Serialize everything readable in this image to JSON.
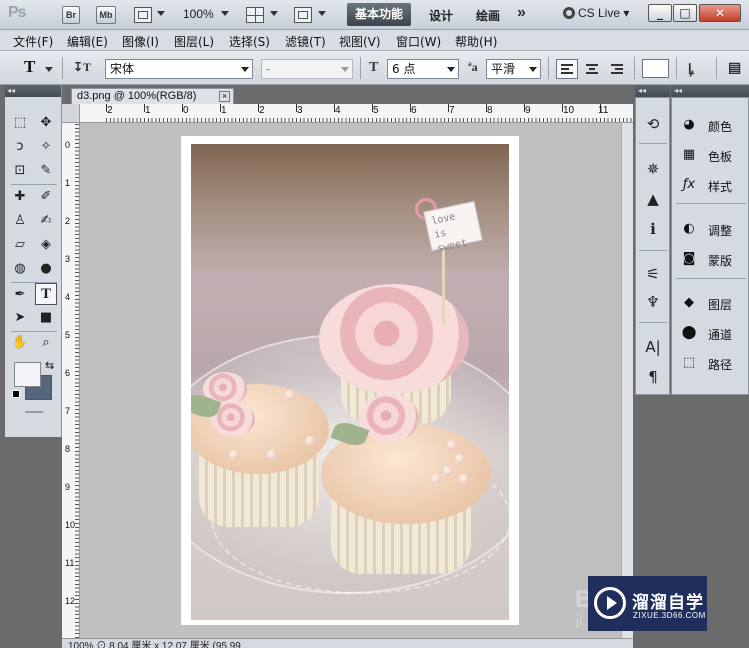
{
  "appbar": {
    "logo": "Ps",
    "bridge_label": "Br",
    "minibridge_label": "Mb",
    "zoom": "100%",
    "workspaces": [
      "基本功能",
      "设计",
      "绘画"
    ],
    "more": "»",
    "cs_live": "CS Live",
    "window_buttons": [
      "_",
      "□",
      "✕"
    ]
  },
  "menu": [
    "文件(F)",
    "编辑(E)",
    "图像(I)",
    "图层(L)",
    "选择(S)",
    "滤镜(T)",
    "视图(V)",
    "窗口(W)",
    "帮助(H)"
  ],
  "options": {
    "tool_glyph": "T",
    "font_family": "宋体",
    "font_style": "-",
    "size_glyph": "T",
    "font_size": "6 点",
    "aa_glyph": "ªa",
    "antialias": "平滑",
    "color_hex": "#ffffff"
  },
  "collapse_glyph": "◂◂",
  "document": {
    "tab_title": "d3.png @ 100%(RGB/8)",
    "tab_close": "×",
    "ruler_h": [
      "2",
      "1",
      "0",
      "1",
      "2",
      "3",
      "4",
      "5",
      "6",
      "7",
      "8",
      "9",
      "10",
      "11"
    ],
    "ruler_v": [
      "0",
      "1",
      "2",
      "3",
      "4",
      "5",
      "6",
      "7",
      "8",
      "9",
      "10",
      "11",
      "12"
    ],
    "photo_sign_text": "love is sweet",
    "status": "100%  ⊙  8.04 厘米 x 12.07 厘米 (95.99 ..."
  },
  "tools": [
    {
      "name": "marquee-tool",
      "glyph": "⬚"
    },
    {
      "name": "move-tool",
      "glyph": "✥"
    },
    {
      "name": "lasso-tool",
      "glyph": "ↄ"
    },
    {
      "name": "quick-select-tool",
      "glyph": "✧"
    },
    {
      "name": "crop-tool",
      "glyph": "⊡"
    },
    {
      "name": "eyedropper-tool",
      "glyph": "✎"
    },
    {
      "name": "healing-tool",
      "glyph": "✚"
    },
    {
      "name": "brush-tool",
      "glyph": "✐"
    },
    {
      "name": "stamp-tool",
      "glyph": "♙"
    },
    {
      "name": "history-brush-tool",
      "glyph": "✍"
    },
    {
      "name": "eraser-tool",
      "glyph": "▱"
    },
    {
      "name": "paint-bucket-tool",
      "glyph": "◈"
    },
    {
      "name": "blur-tool",
      "glyph": "◍"
    },
    {
      "name": "dodge-tool",
      "glyph": "●"
    },
    {
      "name": "pen-tool",
      "glyph": "✒"
    },
    {
      "name": "type-tool",
      "glyph": "T"
    },
    {
      "name": "path-select-tool",
      "glyph": "➤"
    },
    {
      "name": "shape-tool",
      "glyph": "■"
    },
    {
      "name": "hand-tool",
      "glyph": "✋"
    },
    {
      "name": "zoom-tool",
      "glyph": "⌕"
    }
  ],
  "right_strip_icons": [
    "history",
    "navigator",
    "histogram",
    "info",
    "brush-preset",
    "clone-source",
    "character",
    "paragraph"
  ],
  "right_strip_glyphs": [
    "⟲",
    "✵",
    "▲",
    "ℹ",
    "⚟",
    "♆",
    "A|",
    "¶"
  ],
  "panels": [
    {
      "label": "颜色",
      "icon": "palette-icon",
      "glyph": "◕"
    },
    {
      "label": "色板",
      "icon": "swatches-icon",
      "glyph": "▦"
    },
    {
      "label": "样式",
      "icon": "styles-icon",
      "glyph": "ƒx"
    },
    {
      "label": "调整",
      "icon": "adjustments-icon",
      "glyph": "◐"
    },
    {
      "label": "蒙版",
      "icon": "masks-icon",
      "glyph": "◙"
    },
    {
      "label": "图层",
      "icon": "layers-icon",
      "glyph": "◆"
    },
    {
      "label": "通道",
      "icon": "channels-icon",
      "glyph": "⬤"
    },
    {
      "label": "路径",
      "icon": "paths-icon",
      "glyph": "⬚"
    }
  ],
  "watermark": {
    "title": "溜溜自学",
    "subtitle": "ZIXUE.3D66.COM",
    "ghost": "BI",
    "ghost2": "ji"
  }
}
